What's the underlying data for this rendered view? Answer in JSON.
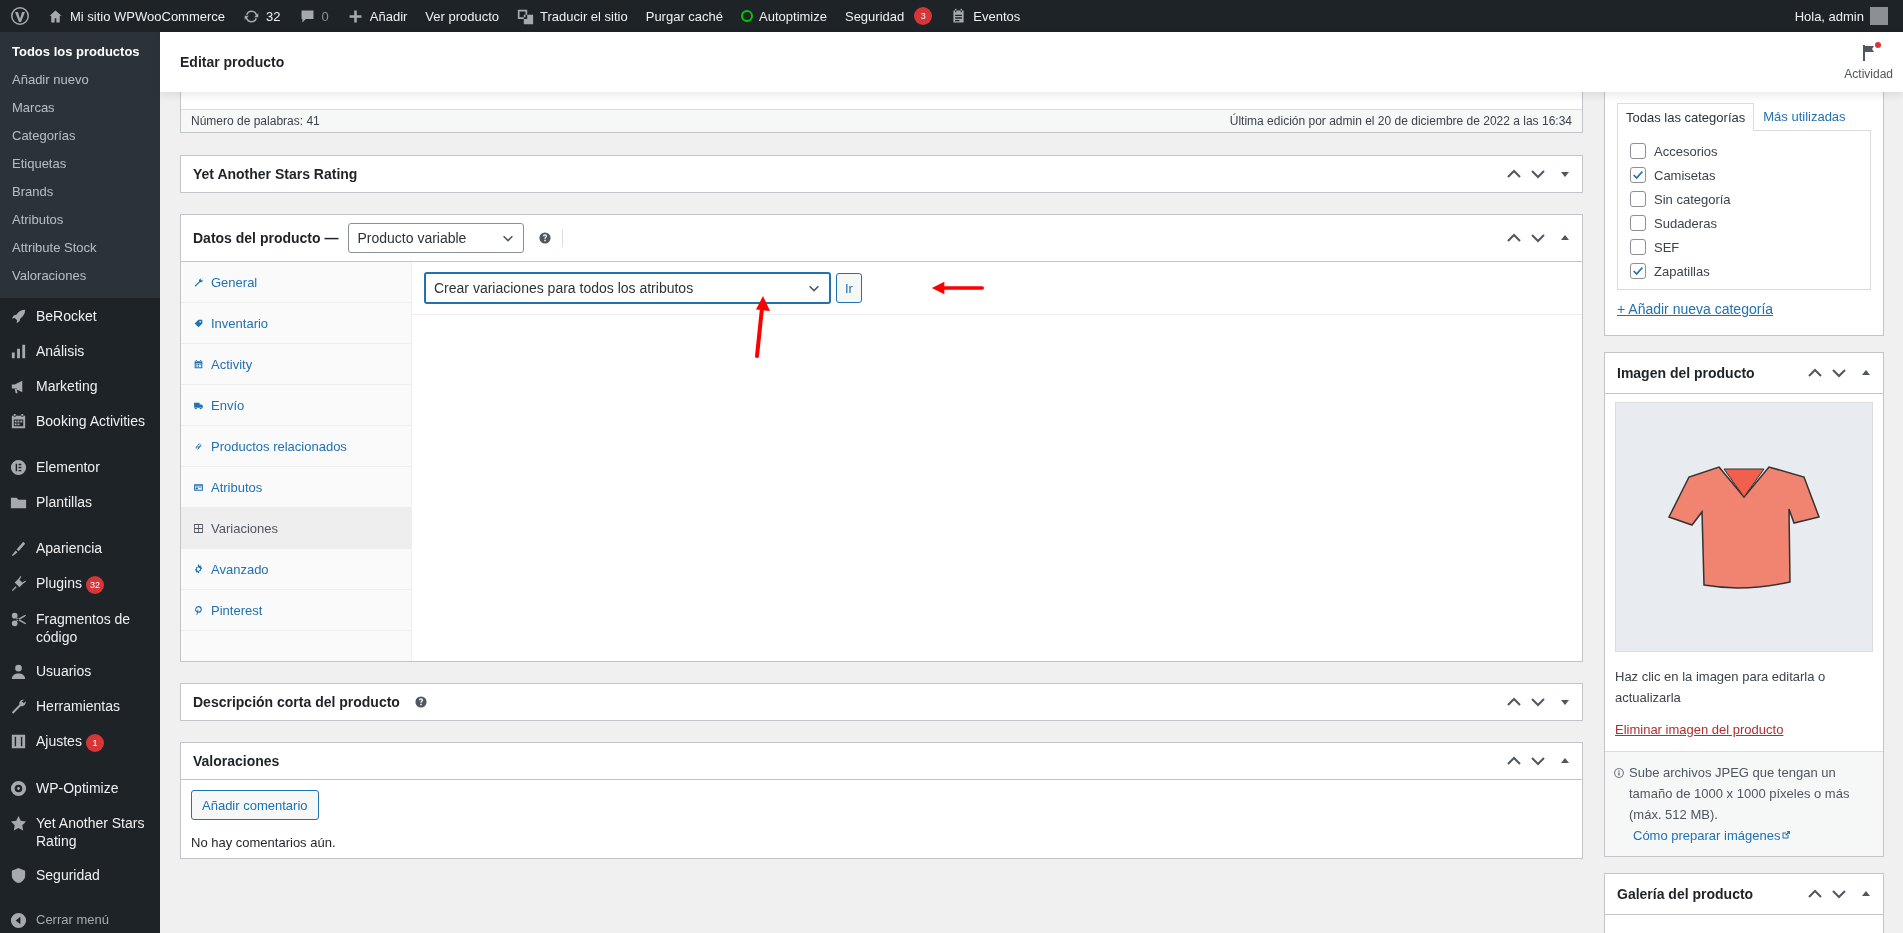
{
  "admin_bar": {
    "site": "Mi sitio WPWooCommerce",
    "updates": "32",
    "comments": "0",
    "new": "Añadir",
    "view": "Ver producto",
    "translate": "Traducir el sitio",
    "purge": "Purgar caché",
    "autoptimize": "Autoptimize",
    "security": "Seguridad",
    "security_badge": "3",
    "events": "Eventos",
    "greeting": "Hola, admin"
  },
  "sidebar": {
    "submenu": [
      {
        "label": "Todos los productos",
        "selected": true
      },
      {
        "label": "Añadir nuevo",
        "selected": false
      },
      {
        "label": "Marcas",
        "selected": false
      },
      {
        "label": "Categorías",
        "selected": false
      },
      {
        "label": "Etiquetas",
        "selected": false
      },
      {
        "label": "Brands",
        "selected": false
      },
      {
        "label": "Atributos",
        "selected": false
      },
      {
        "label": "Attribute Stock",
        "selected": false
      },
      {
        "label": "Valoraciones",
        "selected": false
      }
    ],
    "menu_groups": [
      [
        {
          "label": "BeRocket"
        },
        {
          "label": "Análisis"
        },
        {
          "label": "Marketing"
        },
        {
          "label": "Booking Activities"
        }
      ],
      [
        {
          "label": "Elementor"
        },
        {
          "label": "Plantillas"
        }
      ],
      [
        {
          "label": "Apariencia"
        },
        {
          "label": "Plugins",
          "badge": "32"
        },
        {
          "label": "Fragmentos de código"
        },
        {
          "label": "Usuarios"
        },
        {
          "label": "Herramientas"
        },
        {
          "label": "Ajustes",
          "badge": "1"
        }
      ],
      [
        {
          "label": "WP-Optimize"
        },
        {
          "label": "Yet Another Stars Rating"
        },
        {
          "label": "Seguridad"
        }
      ]
    ],
    "collapse": "Cerrar menú"
  },
  "header": {
    "title": "Editar producto",
    "activity": "Actividad"
  },
  "editor_status": {
    "word_count": "Número de palabras: 41",
    "last_edit": "Última edición por admin el 20 de diciembre de 2022 a las 16:34"
  },
  "stars_panel": {
    "title": "Yet Another Stars Rating",
    "expanded": false
  },
  "product_data": {
    "title": "Datos del producto —",
    "product_type": "Producto variable",
    "expanded": true,
    "tabs": [
      {
        "label": "General",
        "selected": false
      },
      {
        "label": "Inventario",
        "selected": false
      },
      {
        "label": "Activity",
        "selected": false
      },
      {
        "label": "Envío",
        "selected": false
      },
      {
        "label": "Productos relacionados",
        "selected": false
      },
      {
        "label": "Atributos",
        "selected": false
      },
      {
        "label": "Variaciones",
        "selected": true
      },
      {
        "label": "Avanzado",
        "selected": false
      },
      {
        "label": "Pinterest",
        "selected": false
      }
    ],
    "bulk_action": "Crear variaciones para todos los atributos",
    "go_button": "Ir"
  },
  "short_description": {
    "title": "Descripción corta del producto",
    "expanded": false
  },
  "reviews": {
    "title": "Valoraciones",
    "expanded": true,
    "add_button": "Añadir comentario",
    "empty": "No hay comentarios aún."
  },
  "categories": {
    "tabs": [
      {
        "label": "Todas las categorías",
        "selected": true
      },
      {
        "label": "Más utilizadas",
        "selected": false
      }
    ],
    "items": [
      {
        "label": "Accesorios",
        "checked": false
      },
      {
        "label": "Camisetas",
        "checked": true
      },
      {
        "label": "Sin categoría",
        "checked": false
      },
      {
        "label": "Sudaderas",
        "checked": false
      },
      {
        "label": "SEF",
        "checked": false
      },
      {
        "label": "Zapatillas",
        "checked": true
      }
    ],
    "add_link": "+ Añadir nueva categoría"
  },
  "product_image": {
    "title": "Imagen del producto",
    "expanded": true,
    "hint": "Haz clic en la imagen para editarla o actualizarla",
    "remove_link": "Eliminar imagen del producto",
    "note": "Sube archivos JPEG que tengan un tamaño de 1000 x 1000 píxeles o más (máx. 512 MB).",
    "note_link": "Cómo preparar imágenes"
  },
  "gallery": {
    "title": "Galería del producto",
    "expanded": true
  }
}
